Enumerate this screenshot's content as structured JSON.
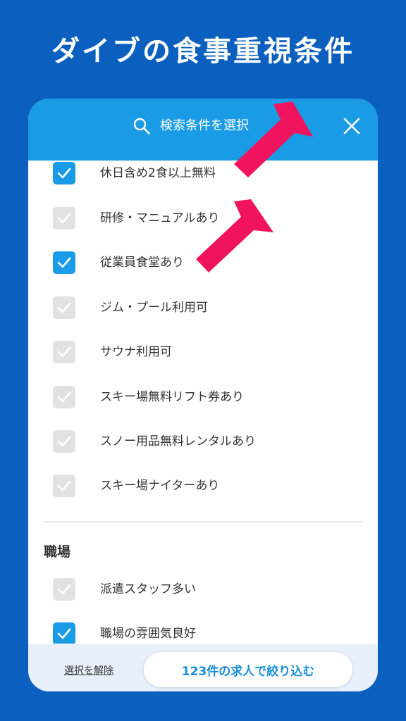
{
  "promo": {
    "title": "ダイブの食事重視条件"
  },
  "modal": {
    "title": "検索条件を選択"
  },
  "options": [
    {
      "label": "休日含め2食以上無料",
      "checked": true
    },
    {
      "label": "研修・マニュアルあり",
      "checked": false
    },
    {
      "label": "従業員食堂あり",
      "checked": true
    },
    {
      "label": "ジム・プール利用可",
      "checked": false
    },
    {
      "label": "サウナ利用可",
      "checked": false
    },
    {
      "label": "スキー場無料リフト券あり",
      "checked": false
    },
    {
      "label": "スノー用品無料レンタルあり",
      "checked": false
    },
    {
      "label": "スキー場ナイターあり",
      "checked": false
    }
  ],
  "section": {
    "heading": "職場"
  },
  "workplace_options": [
    {
      "label": "派遣スタッフ多い",
      "checked": false
    },
    {
      "label": "職場の雰囲気良好",
      "checked": true
    }
  ],
  "footer": {
    "clear_label": "選択を解除",
    "submit_label": "123件の求人で絞り込む"
  },
  "colors": {
    "background": "#0a5fbf",
    "accent": "#1a9be6",
    "arrow": "#f0145f"
  },
  "icons": {
    "search": "search-icon",
    "close": "close-icon",
    "check": "checkmark-icon"
  }
}
